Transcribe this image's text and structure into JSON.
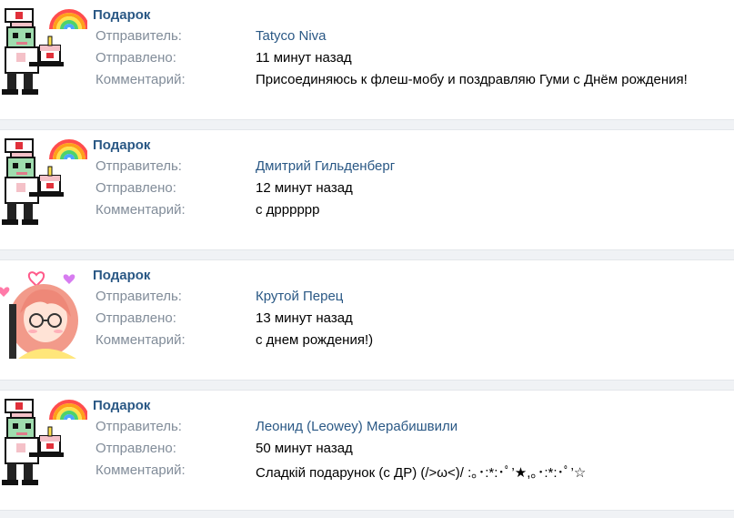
{
  "gifts": [
    {
      "title": "Подарок",
      "sender_label": "Отправитель:",
      "sender": "Tatyco Niva",
      "sent_label": "Отправлено:",
      "sent": "11 минут назад",
      "comment_label": "Комментарий:",
      "comment": "Присоединяюсь к флеш-мобу и поздравляю Гуми с Днём рождения!",
      "image": "pixel-nurse-with-cake-and-rainbow"
    },
    {
      "title": "Подарок",
      "sender_label": "Отправитель:",
      "sender": "Дмитрий Гильденберг",
      "sent_label": "Отправлено:",
      "sent": "12 минут назад",
      "comment_label": "Комментарий:",
      "comment": "с дрррррр",
      "image": "pixel-nurse-with-cake-and-rainbow"
    },
    {
      "title": "Подарок",
      "sender_label": "Отправитель:",
      "sender": "Крутой Перец",
      "sent_label": "Отправлено:",
      "sent": "13 минут назад",
      "comment_label": "Комментарий:",
      "comment": "с днем рождения!)",
      "image": "anime-girl-with-hearts"
    },
    {
      "title": "Подарок",
      "sender_label": "Отправитель:",
      "sender": "Леонид (Leowey) Мерабишвили",
      "sent_label": "Отправлено:",
      "sent": "50 минут назад",
      "comment_label": "Комментарий:",
      "comment": "Сладкій подарунок (с ДР) (/>ω<)/ :｡･:*:･ﾟ’★,｡･:*:･ﾟ’☆",
      "image": "pixel-nurse-with-cake-and-rainbow"
    }
  ],
  "colors": {
    "link": "#2a5885",
    "label": "#818c99",
    "separator": "#f0f2f5"
  }
}
